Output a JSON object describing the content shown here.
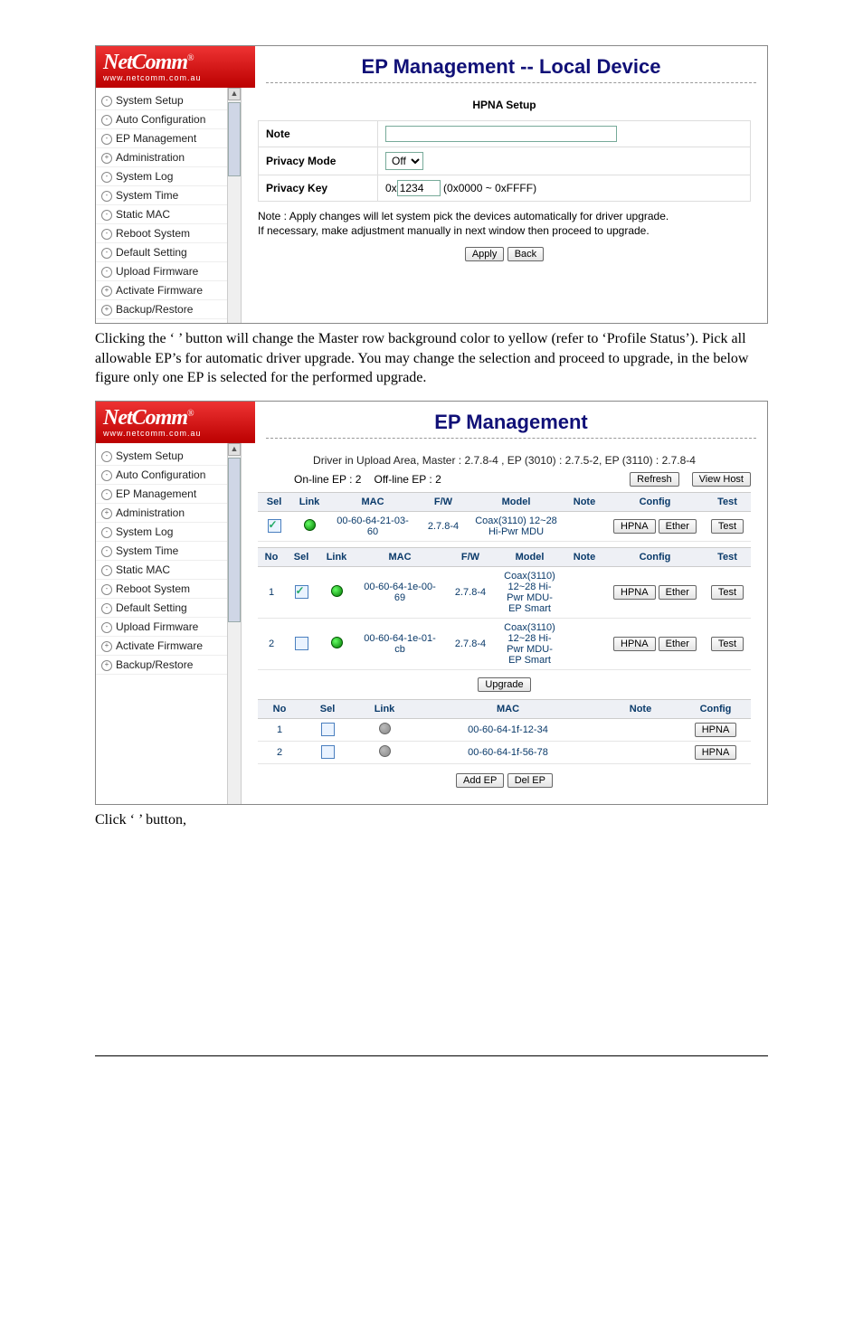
{
  "brand": "NetComm",
  "brand_tag": "www.netcomm.com.au",
  "nav": {
    "items": [
      {
        "label": "System Setup",
        "mark": "-"
      },
      {
        "label": "Auto Configuration",
        "mark": "-"
      },
      {
        "label": "EP Management",
        "mark": "-"
      },
      {
        "label": "Administration",
        "mark": "+"
      },
      {
        "label": "System Log",
        "mark": "-"
      },
      {
        "label": "System Time",
        "mark": "-"
      },
      {
        "label": "Static MAC",
        "mark": "-"
      },
      {
        "label": "Reboot System",
        "mark": "-"
      },
      {
        "label": "Default Setting",
        "mark": "-"
      },
      {
        "label": "Upload Firmware",
        "mark": "-"
      },
      {
        "label": "Activate Firmware",
        "mark": "+"
      },
      {
        "label": "Backup/Restore",
        "mark": "+"
      }
    ]
  },
  "shot1": {
    "title": "EP Management -- Local Device",
    "sub": "HPNA Setup",
    "form": {
      "note_label": "Note",
      "note_value": "",
      "privacy_mode_label": "Privacy Mode",
      "privacy_mode_value": "Off",
      "privacy_key_label": "Privacy Key",
      "privacy_key_prefix": "0x",
      "privacy_key_value": "1234",
      "privacy_key_hint": "(0x0000 ~ 0xFFFF)"
    },
    "note_text1": "Note : Apply changes will let system pick the devices automatically for driver upgrade.",
    "note_text2": "If necessary, make adjustment manually in next window then proceed to upgrade.",
    "btn_apply": "Apply",
    "btn_back": "Back"
  },
  "inter1": "Clicking the ‘           ’ button will change the Master row background color to yellow (refer to ‘Profile Status’). Pick all allowable EP’s for automatic driver upgrade. You may change the selection and proceed to upgrade, in the below figure only one EP is selected for the performed upgrade.",
  "shot2": {
    "title": "EP Management",
    "driver_line": "Driver in Upload Area, Master : 2.7.8-4 ,   EP (3010) : 2.7.5-2,   EP (3110) : 2.7.8-4",
    "online": "On-line EP : 2",
    "offline": "Off-line EP : 2",
    "btn_refresh": "Refresh",
    "btn_viewhost": "View Host",
    "headers_master": [
      "Sel",
      "Link",
      "MAC",
      "F/W",
      "Model",
      "Note",
      "Config",
      "Test"
    ],
    "master_row": {
      "sel": true,
      "link": "on",
      "mac": "00-60-64-21-03-60",
      "fw": "2.7.8-4",
      "model": "Coax(3110) 12~28 Hi-Pwr MDU",
      "note": "",
      "cfg1": "HPNA",
      "cfg2": "Ether",
      "test": "Test"
    },
    "headers_ep": [
      "No",
      "Sel",
      "Link",
      "MAC",
      "F/W",
      "Model",
      "Note",
      "Config",
      "Test"
    ],
    "ep_rows": [
      {
        "no": "1",
        "sel": true,
        "link": "on",
        "mac": "00-60-64-1e-00-69",
        "fw": "2.7.8-4",
        "model": "Coax(3110) 12~28 Hi-Pwr MDU-EP Smart",
        "note": "",
        "cfg1": "HPNA",
        "cfg2": "Ether",
        "test": "Test"
      },
      {
        "no": "2",
        "sel": false,
        "link": "on",
        "mac": "00-60-64-1e-01-cb",
        "fw": "2.7.8-4",
        "model": "Coax(3110) 12~28 Hi-Pwr MDU-EP Smart",
        "note": "",
        "cfg1": "HPNA",
        "cfg2": "Ether",
        "test": "Test"
      }
    ],
    "btn_upgrade": "Upgrade",
    "headers_off": [
      "No",
      "Sel",
      "Link",
      "MAC",
      "Note",
      "Config"
    ],
    "off_rows": [
      {
        "no": "1",
        "sel": false,
        "link": "off",
        "mac": "00-60-64-1f-12-34",
        "note": "",
        "cfg": "HPNA"
      },
      {
        "no": "2",
        "sel": false,
        "link": "off",
        "mac": "00-60-64-1f-56-78",
        "note": "",
        "cfg": "HPNA"
      }
    ],
    "btn_addep": "Add EP",
    "btn_delep": "Del EP"
  },
  "after2": "Click ‘               ’ button,"
}
